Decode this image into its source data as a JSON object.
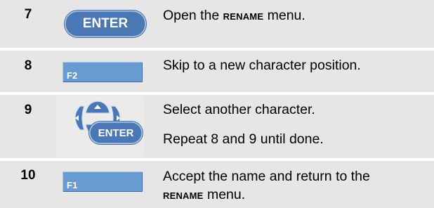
{
  "steps": [
    {
      "number": "7",
      "key": "ENTER",
      "text_before": "Open the ",
      "text_emphasis": "RENAME",
      "text_after": " menu."
    },
    {
      "number": "8",
      "key": "F2",
      "text": "Skip to a new character position."
    },
    {
      "number": "9",
      "key": "ENTER",
      "text": "Select another character.",
      "text2": "Repeat 8 and 9 until done."
    },
    {
      "number": "10",
      "key": "F1",
      "text_line1": "Accept the name and return to the",
      "text_emphasis": "RENAME",
      "text_after": " menu."
    }
  ],
  "colors": {
    "row_background": "#e6e6e6",
    "key_blue": "#4a78b5",
    "fkey_blue": "#6a9bd0"
  }
}
